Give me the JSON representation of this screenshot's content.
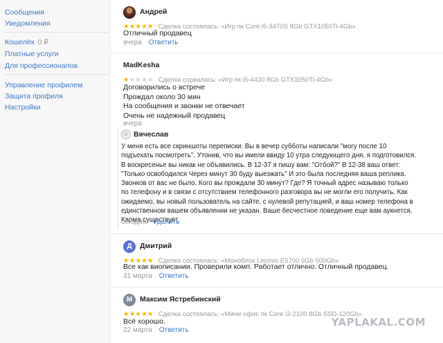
{
  "sidebar": {
    "messages": "Сообщения",
    "notifications": "Уведомления",
    "wallet_label": "Кошелёк",
    "wallet_value": "0 ₽",
    "paid_services": "Платные услуги",
    "for_pros": "Для профессионалов",
    "manage_profile": "Управление профилем",
    "profile_protection": "Защита профиля",
    "settings": "Настройки"
  },
  "reviews": [
    {
      "author": "Андрей",
      "rating": 5,
      "stars_on": "★★★★★",
      "stars_off": "",
      "deal": "Сделка состоялась: «Игр пк Core i5-3470S 8Gb GTX1050Ti-4Gb»",
      "lines": [
        "Отличный продавец"
      ],
      "date": "вчера",
      "action": "Ответить"
    },
    {
      "author": "MadKesha",
      "rating": 1,
      "stars_on": "★",
      "stars_off": "★★★★",
      "deal": "Сделка сорвалась: «Игр пк i5-4430 8Gb GTX1050Ti-4Gb»",
      "lines": [
        "Договорились о встрече",
        "Прождал около 30 мин",
        "На сообщения и звонки не отвечает",
        "Очень не надежный продавец"
      ],
      "date": "вчера",
      "reply": {
        "author": "Вячеслав",
        "lines": [
          "У меня есть все скриншоты переписки. Вы в вечер субботы написали \"могу после 10",
          "подъехать посмотреть\". Утонив, что вы имели ввиду 10 утра следующего дня, я подготовился.",
          "В воскресенье вы никак не объявились. В 12-37 я пишу вам: \"Отбой?\" В 12-38 ваш ответ:",
          "\"Только освободился Через минут 30 буду выезжать\" И это была последняя ваша реплика.",
          "Звонков от вас не было. Кого вы прождали 30 минут? Где? Я точный адрес называю только",
          "по телефону и в связи с отсутствием телефонного разговора вы не могли его получить. Как",
          "ожидаемо, вы новый пользователь на сайте, с нулевой репутацией, и ваш номер телефона в",
          "единственном вашем объявлении не указан. Ваше бесчестное поведение еще вам аукнется.",
          "Карма существует."
        ],
        "date": "сегодня",
        "action": "Удалить"
      }
    },
    {
      "author": "Дмитрий",
      "initial": "Д",
      "rating": 5,
      "stars_on": "★★★★★",
      "stars_off": "",
      "deal": "Сделка состоялась: «Моноблок Lenovo E5700 6Gb 500Gb»",
      "lines": [
        "Все как виописании. Проверили комп. Работает отлично. Отличный продавец."
      ],
      "date": "31 марта",
      "action": "Ответить"
    },
    {
      "author": "Максим Ястребинский",
      "initial": "М",
      "rating": 5,
      "stars_on": "★★★★★",
      "stars_off": "",
      "deal": "Сделка состоялась: «Мини офис пк Core i3-2100 8Gb SSD-120Gb»",
      "lines": [
        "Всё хорошо."
      ],
      "date": "22 марта",
      "action": "Ответить"
    }
  ],
  "watermark": "YAPLAKAL.COM"
}
